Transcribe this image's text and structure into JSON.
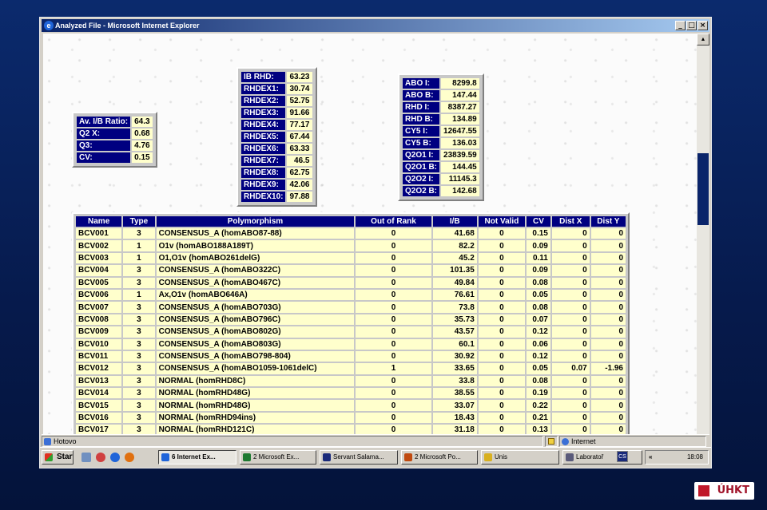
{
  "window": {
    "title": "Analyzed File - Microsoft Internet Explorer",
    "minimize": "_",
    "maximize": "□",
    "close": "×"
  },
  "summary": {
    "rows": [
      {
        "label": "Av. I/B Ratio:",
        "value": "64.3"
      },
      {
        "label": "Q2 X:",
        "value": "0.68"
      },
      {
        "label": "Q3:",
        "value": "4.76"
      },
      {
        "label": "CV:",
        "value": "0.15"
      }
    ]
  },
  "rhd": {
    "rows": [
      {
        "label": "IB RHD:",
        "value": "63.23"
      },
      {
        "label": "RHDEX1:",
        "value": "30.74"
      },
      {
        "label": "RHDEX2:",
        "value": "52.75"
      },
      {
        "label": "RHDEX3:",
        "value": "91.66"
      },
      {
        "label": "RHDEX4:",
        "value": "77.17"
      },
      {
        "label": "RHDEX5:",
        "value": "67.44"
      },
      {
        "label": "RHDEX6:",
        "value": "63.33"
      },
      {
        "label": "RHDEX7:",
        "value": "46.5"
      },
      {
        "label": "RHDEX8:",
        "value": "62.75"
      },
      {
        "label": "RHDEX9:",
        "value": "42.06"
      },
      {
        "label": "RHDEX10:",
        "value": "97.88"
      }
    ]
  },
  "abo": {
    "rows": [
      {
        "label": "ABO I:",
        "value": "8299.8"
      },
      {
        "label": "ABO B:",
        "value": "147.44"
      },
      {
        "label": "RHD I:",
        "value": "8387.27"
      },
      {
        "label": "RHD B:",
        "value": "134.89"
      },
      {
        "label": "CY5 I:",
        "value": "12647.55"
      },
      {
        "label": "CY5 B:",
        "value": "136.03"
      },
      {
        "label": "Q2O1 I:",
        "value": "23839.59"
      },
      {
        "label": "Q2O1 B:",
        "value": "144.45"
      },
      {
        "label": "Q2O2 I:",
        "value": "11145.3"
      },
      {
        "label": "Q2O2 B:",
        "value": "142.68"
      }
    ]
  },
  "table": {
    "headers": [
      "Name",
      "Type",
      "Polymorphism",
      "Out of Rank",
      "I/B",
      "Not Valid",
      "CV",
      "Dist X",
      "Dist Y"
    ],
    "rows": [
      [
        "BCV001",
        "3",
        "CONSENSUS_A (homABO87-88)",
        "0",
        "41.68",
        "0",
        "0.15",
        "0",
        "0"
      ],
      [
        "BCV002",
        "1",
        "O1v (homABO188A189T)",
        "0",
        "82.2",
        "0",
        "0.09",
        "0",
        "0"
      ],
      [
        "BCV003",
        "1",
        "O1,O1v (homABO261delG)",
        "0",
        "45.2",
        "0",
        "0.11",
        "0",
        "0"
      ],
      [
        "BCV004",
        "3",
        "CONSENSUS_A (homABO322C)",
        "0",
        "101.35",
        "0",
        "0.09",
        "0",
        "0"
      ],
      [
        "BCV005",
        "3",
        "CONSENSUS_A (homABO467C)",
        "0",
        "49.84",
        "0",
        "0.08",
        "0",
        "0"
      ],
      [
        "BCV006",
        "1",
        "Ax,O1v (homABO646A)",
        "0",
        "76.61",
        "0",
        "0.05",
        "0",
        "0"
      ],
      [
        "BCV007",
        "3",
        "CONSENSUS_A (homABO703G)",
        "0",
        "73.8",
        "0",
        "0.08",
        "0",
        "0"
      ],
      [
        "BCV008",
        "3",
        "CONSENSUS_A (homABO796C)",
        "0",
        "35.73",
        "0",
        "0.07",
        "0",
        "0"
      ],
      [
        "BCV009",
        "3",
        "CONSENSUS_A (homABO802G)",
        "0",
        "43.57",
        "0",
        "0.12",
        "0",
        "0"
      ],
      [
        "BCV010",
        "3",
        "CONSENSUS_A (homABO803G)",
        "0",
        "60.1",
        "0",
        "0.06",
        "0",
        "0"
      ],
      [
        "BCV011",
        "3",
        "CONSENSUS_A (homABO798-804)",
        "0",
        "30.92",
        "0",
        "0.12",
        "0",
        "0"
      ],
      [
        "BCV012",
        "3",
        "CONSENSUS_A (homABO1059-1061delC)",
        "1",
        "33.65",
        "0",
        "0.05",
        "0.07",
        "-1.96"
      ],
      [
        "BCV013",
        "3",
        "NORMAL (homRHD8C)",
        "0",
        "33.8",
        "0",
        "0.08",
        "0",
        "0"
      ],
      [
        "BCV014",
        "3",
        "NORMAL (homRHD48G)",
        "0",
        "38.55",
        "0",
        "0.19",
        "0",
        "0"
      ],
      [
        "BCV015",
        "3",
        "NORMAL (homRHD48G)",
        "0",
        "33.07",
        "0",
        "0.22",
        "0",
        "0"
      ],
      [
        "BCV016",
        "3",
        "NORMAL (homRHD94ins)",
        "0",
        "18.43",
        "0",
        "0.21",
        "0",
        "0"
      ],
      [
        "BCV017",
        "3",
        "NORMAL (homRHD121C)",
        "0",
        "31.18",
        "0",
        "0.13",
        "0",
        "0"
      ]
    ]
  },
  "status": {
    "text": "Hotovo",
    "zone": "Internet"
  },
  "taskbar": {
    "start": "Start",
    "tasks": [
      {
        "label": "6 Internet Ex...",
        "color": "#1f64d9"
      },
      {
        "label": "2 Microsoft Ex...",
        "color": "#1e7a32"
      },
      {
        "label": "Servant Salama...",
        "color": "#1a2a7a"
      },
      {
        "label": "2 Microsoft Po...",
        "color": "#c04a10"
      },
      {
        "label": "Unis",
        "color": "#d8b020"
      },
      {
        "label": "Laboratoř",
        "color": "#5a5a7a"
      }
    ],
    "lang": "CS",
    "clock": "18:08"
  },
  "logo": {
    "text": "ÚHKT"
  }
}
